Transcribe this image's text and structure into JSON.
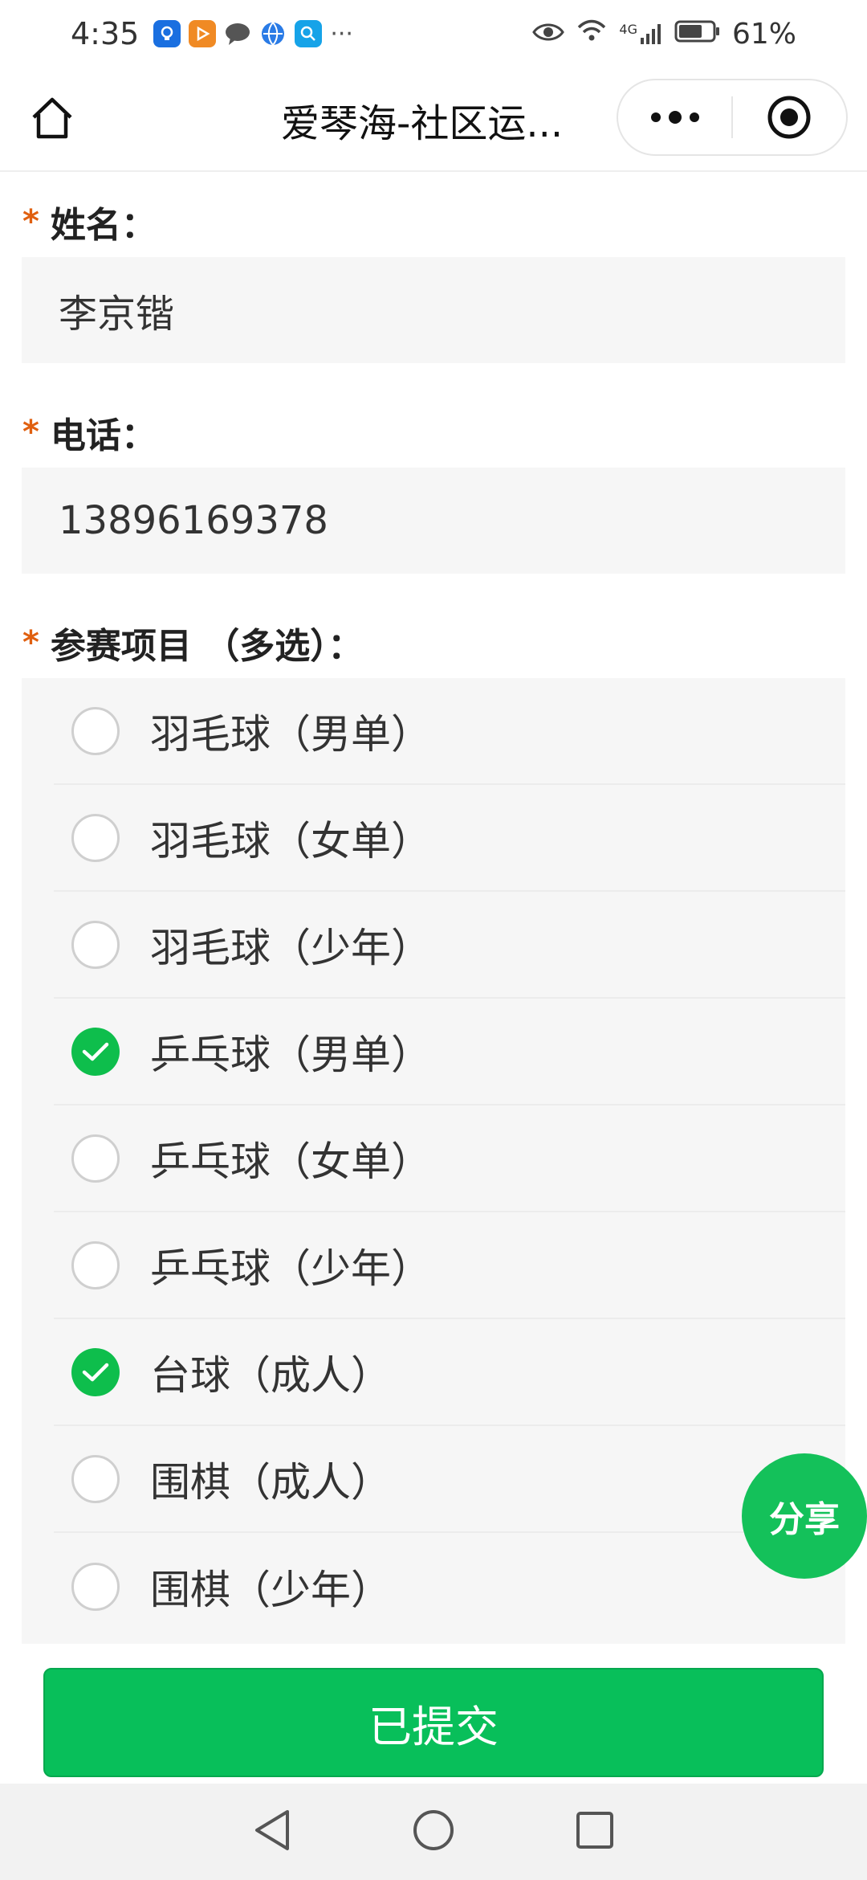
{
  "status_bar": {
    "time": "4:35",
    "more": "···",
    "battery_percent": "61%",
    "network": "4G",
    "icons": [
      "bulb-app-icon",
      "play-app-icon",
      "chat-app-icon",
      "globe-app-icon",
      "search-app-icon",
      "eye-icon",
      "wifi-icon",
      "signal-icon",
      "battery-icon"
    ]
  },
  "nav": {
    "title": "爱琴海-社区运..."
  },
  "form": {
    "name_label": "姓名：",
    "name_value": "李京锴",
    "phone_label": "电话：",
    "phone_value": "13896169378",
    "events_label": "参赛项目 （多选）：",
    "required_mark": "*",
    "options": [
      {
        "label": "羽毛球（男单）",
        "checked": false
      },
      {
        "label": "羽毛球（女单）",
        "checked": false
      },
      {
        "label": "羽毛球（少年）",
        "checked": false
      },
      {
        "label": "乒乓球（男单）",
        "checked": true
      },
      {
        "label": "乒乓球（女单）",
        "checked": false
      },
      {
        "label": "乒乓球（少年）",
        "checked": false
      },
      {
        "label": "台球（成人）",
        "checked": true
      },
      {
        "label": "围棋（成人）",
        "checked": false
      },
      {
        "label": "围棋（少年）",
        "checked": false
      }
    ]
  },
  "share_label": "分享",
  "submit_label": "已提交",
  "colors": {
    "accent_green": "#08bf5a",
    "required_star": "#e06010"
  }
}
